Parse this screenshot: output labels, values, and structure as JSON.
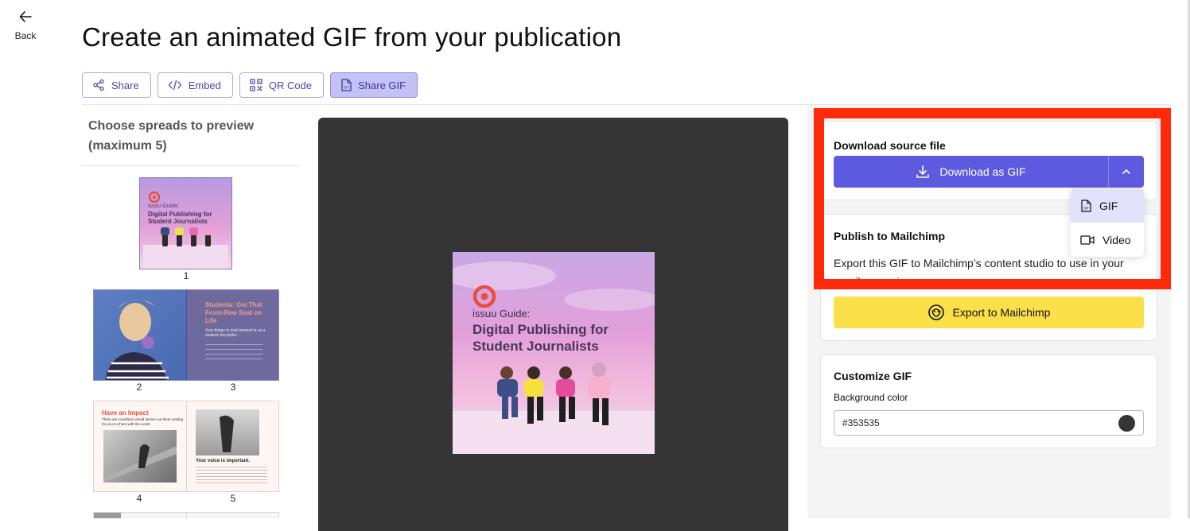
{
  "back": {
    "label": "Back"
  },
  "page_title": "Create an animated GIF from your publication",
  "tabs": [
    {
      "label": "Share",
      "icon": "share-icon",
      "active": false
    },
    {
      "label": "Embed",
      "icon": "code-icon",
      "active": false
    },
    {
      "label": "QR Code",
      "icon": "qr-code-icon",
      "active": false
    },
    {
      "label": "Share GIF",
      "icon": "gif-file-icon",
      "active": true
    }
  ],
  "spreads": {
    "heading": "Choose spreads to preview (maximum 5)",
    "page_numbers": [
      "1",
      "2",
      "3",
      "4",
      "5"
    ],
    "cover_text": {
      "brand": "issuu Guide:",
      "title_line1": "Digital Publishing for",
      "title_line2": "Student Journalists"
    },
    "spread23_text": {
      "headline": "Students: Get That Front-Row Seat on Life",
      "sub": "Your things to look forward to as a student storyteller:"
    },
    "spread45_text": {
      "headline": "Have an Impact",
      "sub": "There are countless untold stories out there waiting for you to share with the world.",
      "right_headline": "Your voice is important."
    }
  },
  "preview": {
    "cover_brand": "issuu Guide:",
    "cover_title_line1": "Digital Publishing for",
    "cover_title_line2": "Student Journalists"
  },
  "download_card": {
    "title": "Download source file",
    "button_label": "Download as GIF"
  },
  "format_dropdown": {
    "options": [
      {
        "label": "GIF",
        "icon": "gif-file-icon",
        "selected": true
      },
      {
        "label": "Video",
        "icon": "video-icon",
        "selected": false
      }
    ]
  },
  "mailchimp_card": {
    "title": "Publish to Mailchimp",
    "description": "Export this GIF to Mailchimp’s content studio to use in your email campaigns",
    "button_label": "Export to Mailchimp"
  },
  "customize_card": {
    "title": "Customize GIF",
    "bg_label": "Background color",
    "bg_value": "#353535"
  },
  "colors": {
    "accent": "#5d5ae0",
    "mailchimp_yellow": "#fbe04a",
    "preview_bg": "#353535",
    "highlight": "#ff2a0a"
  }
}
